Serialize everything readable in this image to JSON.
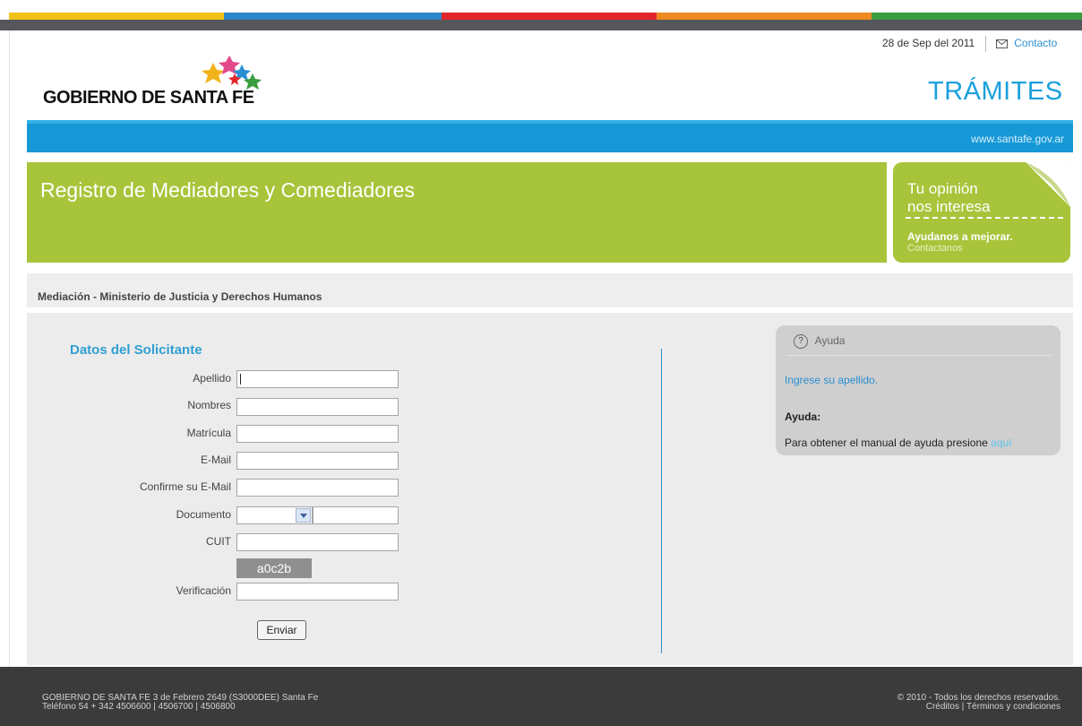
{
  "colors": {
    "stripes": [
      "#f3c219",
      "#2986c9",
      "#e2262c",
      "#ef8a20",
      "#3a9d3f"
    ],
    "blue_bar": "#1698d6",
    "green_banner": "#a8c43a",
    "accent_text": "#2f9fd4"
  },
  "header": {
    "logo_text": "GOBIERNO DE SANTA FE",
    "date": "28 de Sep del 2011",
    "contact_icon": "mail-icon",
    "contact_link": "Contacto",
    "section_title": "TRÁMITES",
    "site_url": "www.santafe.gov.ar"
  },
  "banner": {
    "title": "Registro de Mediadores y Comediadores"
  },
  "opinion": {
    "line1": "Tu opinión",
    "line2": "nos interesa",
    "cta": "Ayudanos a mejorar.",
    "link": "Contactanos"
  },
  "breadcrumb": "Mediación - Ministerio de Justicia y Derechos Humanos",
  "form": {
    "heading": "Datos del Solicitante",
    "labels": {
      "apellido": "Apellido",
      "nombres": "Nombres",
      "matricula": "Matrícula",
      "email": "E-Mail",
      "email_confirm": "Confirme su E-Mail",
      "documento": "Documento",
      "cuit": "CUIT",
      "verificacion": "Verificación"
    },
    "values": {
      "apellido": "",
      "nombres": "",
      "matricula": "",
      "email": "",
      "email_confirm": "",
      "documento_tipo": "",
      "documento_numero": "",
      "cuit": "",
      "verificacion": ""
    },
    "captcha_text": "a0c2b",
    "submit_label": "Enviar"
  },
  "help": {
    "header": "Ayuda",
    "hint": "Ingrese su apellido.",
    "subtitle": "Ayuda:",
    "manual_text": "Para obtener el manual de ayuda presione ",
    "manual_link": "aquí"
  },
  "footer": {
    "left_line1": "GOBIERNO DE SANTA FE 3 de Febrero 2649 (S3000DEE) Santa Fe",
    "left_line2": "Teléfono 54 + 342 4506600 | 4506700 | 4506800",
    "right_line1": "© 2010 - Todos los derechos reservados.",
    "right_line2": "Créditos | Términos y condiciones"
  }
}
